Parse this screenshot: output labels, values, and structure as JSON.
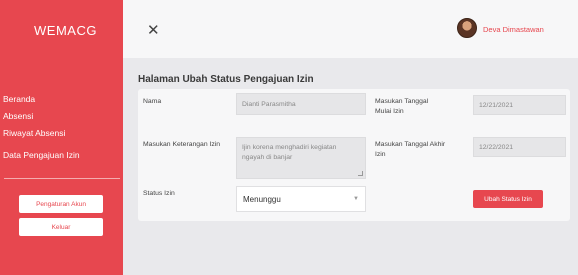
{
  "sidebar": {
    "logo": "WEMACG",
    "items": [
      {
        "label": "Beranda"
      },
      {
        "label": "Absensi"
      },
      {
        "label": "Riwayat Absensi"
      },
      {
        "label": "Data Pengajuan Izin"
      }
    ],
    "settings_button": "Pengaturan Akun",
    "logout_button": "Keluar"
  },
  "topbar": {
    "close_icon": "close-icon",
    "avatar_icon": "avatar",
    "username": "Deva Dimastawan"
  },
  "main": {
    "title": "Halaman Ubah Status Pengajuan Izin",
    "form": {
      "name_label": "Nama",
      "name_value": "Dianti Parasmitha",
      "note_label": "Masukan Keterangan Izin",
      "note_value": "Ijin korena menghadiri kegiatan ngayah di banjar",
      "start_label": "Masukan Tanggal Mulai Izin",
      "start_value": "12/21/2021",
      "end_label": "Masukan Tanggal Akhir Izin",
      "end_value": "12/22/2021",
      "status_label": "Status Izin",
      "status_value": "Menunggu",
      "submit_button": "Ubah Status Izin"
    }
  },
  "colors": {
    "accent": "#e7474f",
    "background": "#e9e9ec",
    "card": "#f7f7f8"
  }
}
